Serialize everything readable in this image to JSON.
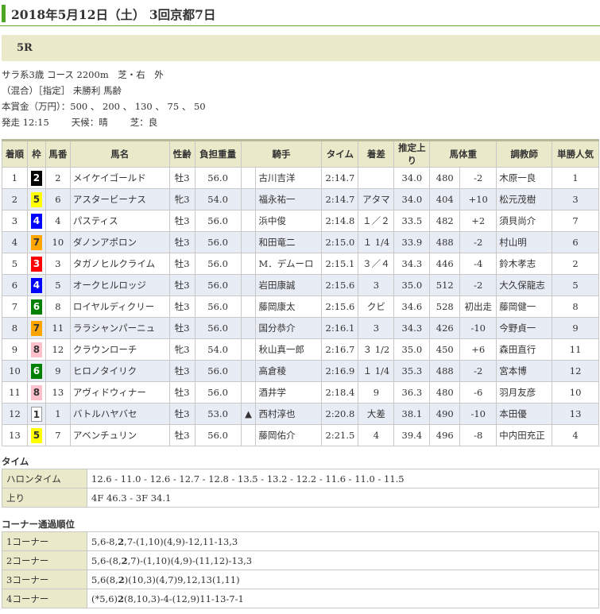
{
  "header": {
    "title": "2018年5月12日（土） 3回京都7日"
  },
  "race": {
    "number": "5R"
  },
  "info": {
    "line1": "サラ系3歳 コース 2200m　芝・右　外",
    "line2": "（混合）［指定］ 未勝利 馬齢",
    "line3": "本賞金（万円）：500 、 200 、 130 、 75 、 50",
    "start": "発走 12:15",
    "weather": "天候：晴",
    "track": "芝：良"
  },
  "columns": [
    "着順",
    "枠",
    "馬番",
    "馬名",
    "性齢",
    "負担重量",
    "騎手",
    "タイム",
    "着差",
    "推定上り",
    "馬体重",
    "調教師",
    "単勝人気"
  ],
  "waku_colors": {
    "1": {
      "bg": "#ffffff",
      "fg": "#333333"
    },
    "2": {
      "bg": "#000000",
      "fg": "#ffffff"
    },
    "3": {
      "bg": "#ff0000",
      "fg": "#ffffff"
    },
    "4": {
      "bg": "#0000ff",
      "fg": "#ffffff"
    },
    "5": {
      "bg": "#ffff00",
      "fg": "#333333"
    },
    "6": {
      "bg": "#008000",
      "fg": "#ffffff"
    },
    "7": {
      "bg": "#ffa500",
      "fg": "#333333"
    },
    "8": {
      "bg": "#ffc0cb",
      "fg": "#333333"
    }
  },
  "rows": [
    {
      "pos": "1",
      "waku": "2",
      "num": "2",
      "name": "メイケイゴールド",
      "sex": "牡3",
      "wt": "56.0",
      "mark": "",
      "jockey": "古川吉洋",
      "time": "2:14.7",
      "margin": "",
      "agari": "34.0",
      "bw": "480",
      "diff": "-2",
      "trainer": "木原一良",
      "pop": "1"
    },
    {
      "pos": "2",
      "waku": "5",
      "num": "6",
      "name": "アスタービーナス",
      "sex": "牝3",
      "wt": "54.0",
      "mark": "",
      "jockey": "福永祐一",
      "time": "2:14.7",
      "margin": "アタマ",
      "agari": "34.0",
      "bw": "404",
      "diff": "+10",
      "trainer": "松元茂樹",
      "pop": "3"
    },
    {
      "pos": "3",
      "waku": "4",
      "num": "4",
      "name": "パスティス",
      "sex": "牡3",
      "wt": "56.0",
      "mark": "",
      "jockey": "浜中俊",
      "time": "2:14.8",
      "margin": "１／２",
      "agari": "33.5",
      "bw": "482",
      "diff": "+2",
      "trainer": "須貝尚介",
      "pop": "7"
    },
    {
      "pos": "4",
      "waku": "7",
      "num": "10",
      "name": "ダノンアポロン",
      "sex": "牡3",
      "wt": "56.0",
      "mark": "",
      "jockey": "和田竜二",
      "time": "2:15.0",
      "margin": "１ 1/4",
      "agari": "33.9",
      "bw": "488",
      "diff": "-2",
      "trainer": "村山明",
      "pop": "6"
    },
    {
      "pos": "5",
      "waku": "3",
      "num": "3",
      "name": "タガノヒルクライム",
      "sex": "牡3",
      "wt": "56.0",
      "mark": "",
      "jockey": "M．デムーロ",
      "time": "2:15.1",
      "margin": "３／４",
      "agari": "34.3",
      "bw": "446",
      "diff": "-4",
      "trainer": "鈴木孝志",
      "pop": "2"
    },
    {
      "pos": "6",
      "waku": "4",
      "num": "5",
      "name": "オークヒルロッジ",
      "sex": "牡3",
      "wt": "56.0",
      "mark": "",
      "jockey": "岩田康誠",
      "time": "2:15.6",
      "margin": "3",
      "agari": "35.0",
      "bw": "512",
      "diff": "-2",
      "trainer": "大久保龍志",
      "pop": "5"
    },
    {
      "pos": "7",
      "waku": "6",
      "num": "8",
      "name": "ロイヤルディクリー",
      "sex": "牡3",
      "wt": "56.0",
      "mark": "",
      "jockey": "藤岡康太",
      "time": "2:15.6",
      "margin": "クビ",
      "agari": "34.6",
      "bw": "528",
      "diff": "初出走",
      "trainer": "藤岡健一",
      "pop": "8"
    },
    {
      "pos": "8",
      "waku": "7",
      "num": "11",
      "name": "ララシャンパーニュ",
      "sex": "牡3",
      "wt": "56.0",
      "mark": "",
      "jockey": "国分恭介",
      "time": "2:16.1",
      "margin": "3",
      "agari": "34.3",
      "bw": "426",
      "diff": "-10",
      "trainer": "今野貞一",
      "pop": "9"
    },
    {
      "pos": "9",
      "waku": "8",
      "num": "12",
      "name": "クラウンローチ",
      "sex": "牝3",
      "wt": "54.0",
      "mark": "",
      "jockey": "秋山真一郎",
      "time": "2:16.7",
      "margin": "３ 1/2",
      "agari": "35.0",
      "bw": "450",
      "diff": "+6",
      "trainer": "森田直行",
      "pop": "11"
    },
    {
      "pos": "10",
      "waku": "6",
      "num": "9",
      "name": "ヒロノタイリク",
      "sex": "牡3",
      "wt": "56.0",
      "mark": "",
      "jockey": "高倉稜",
      "time": "2:16.9",
      "margin": "１ 1/4",
      "agari": "35.3",
      "bw": "488",
      "diff": "-2",
      "trainer": "宮本博",
      "pop": "12"
    },
    {
      "pos": "11",
      "waku": "8",
      "num": "13",
      "name": "アヴィドウィナー",
      "sex": "牡3",
      "wt": "56.0",
      "mark": "",
      "jockey": "酒井学",
      "time": "2:18.4",
      "margin": "9",
      "agari": "36.3",
      "bw": "480",
      "diff": "-6",
      "trainer": "羽月友彦",
      "pop": "10"
    },
    {
      "pos": "12",
      "waku": "1",
      "num": "1",
      "name": "バトルハヤバセ",
      "sex": "牡3",
      "wt": "53.0",
      "mark": "▲",
      "jockey": "西村淳也",
      "time": "2:20.8",
      "margin": "大差",
      "agari": "38.1",
      "bw": "490",
      "diff": "-10",
      "trainer": "本田優",
      "pop": "13"
    },
    {
      "pos": "13",
      "waku": "5",
      "num": "7",
      "name": "アベンチュリン",
      "sex": "牡3",
      "wt": "56.0",
      "mark": "",
      "jockey": "藤岡佑介",
      "time": "2:21.5",
      "margin": "4",
      "agari": "39.4",
      "bw": "496",
      "diff": "-8",
      "trainer": "中内田充正",
      "pop": "4"
    }
  ],
  "time_section": {
    "title": "タイム",
    "furlong_label": "ハロンタイム",
    "furlong": "12.6 - 11.0 - 12.6 - 12.7 - 12.8 - 13.5 - 13.2 - 12.2 - 11.6 - 11.0 - 11.5",
    "agari_label": "上り",
    "agari": "4F 46.3 - 3F 34.1"
  },
  "corner_section": {
    "title": "コーナー通過順位",
    "corners": [
      {
        "label": "1コーナー",
        "before": "5,6-8,",
        "bold": "2",
        "after": ",7-(1,10)(4,9)-12,11-13,3"
      },
      {
        "label": "2コーナー",
        "before": "5,6-(8,",
        "bold": "2",
        "after": ",7)-(1,10)(4,9)-(11,12)-13,3"
      },
      {
        "label": "3コーナー",
        "before": "5,6(8,",
        "bold": "2",
        "after": ")(10,3)(4,7)9,12,13(1,11)"
      },
      {
        "label": "4コーナー",
        "before": "(*5,6)",
        "bold": "2",
        "after": "(8,10,3)-4-(12,9)11-13-7-1"
      }
    ]
  }
}
